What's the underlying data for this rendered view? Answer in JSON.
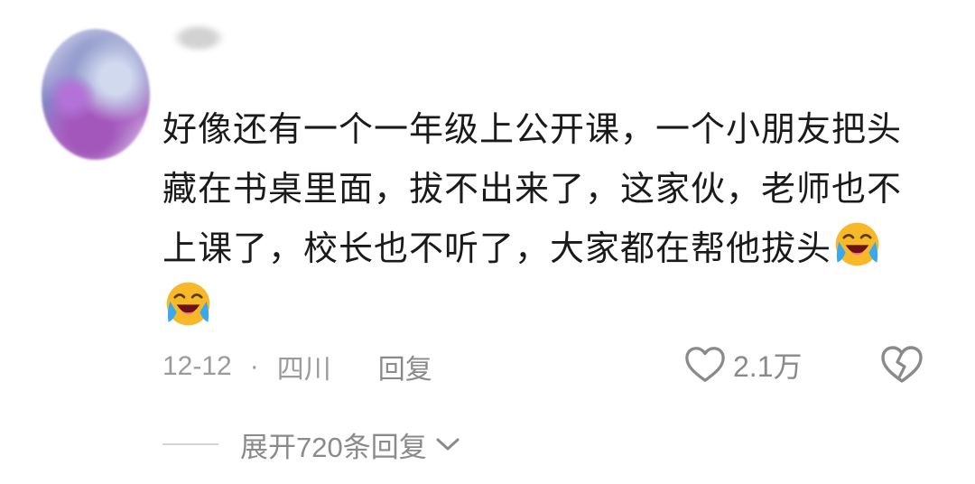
{
  "comment": {
    "username": "",
    "text": "好像还有一个一年级上公开课，一个小朋友把头藏在书桌里面，拔不出来了，这家伙，老师也不上课了，校长也不听了，大家都在帮他拔头",
    "emojis": [
      "laughing-crying-emoji",
      "laughing-crying-emoji"
    ],
    "date": "12-12",
    "separator": "·",
    "location": "四川",
    "reply_label": "回复",
    "likes": "2.1万",
    "expand_label": "展开720条回复"
  },
  "colors": {
    "text": "#1a1a1a",
    "meta": "#9b9b9b",
    "emoji_face": "#f7b929",
    "tears": "#38a9f0"
  }
}
